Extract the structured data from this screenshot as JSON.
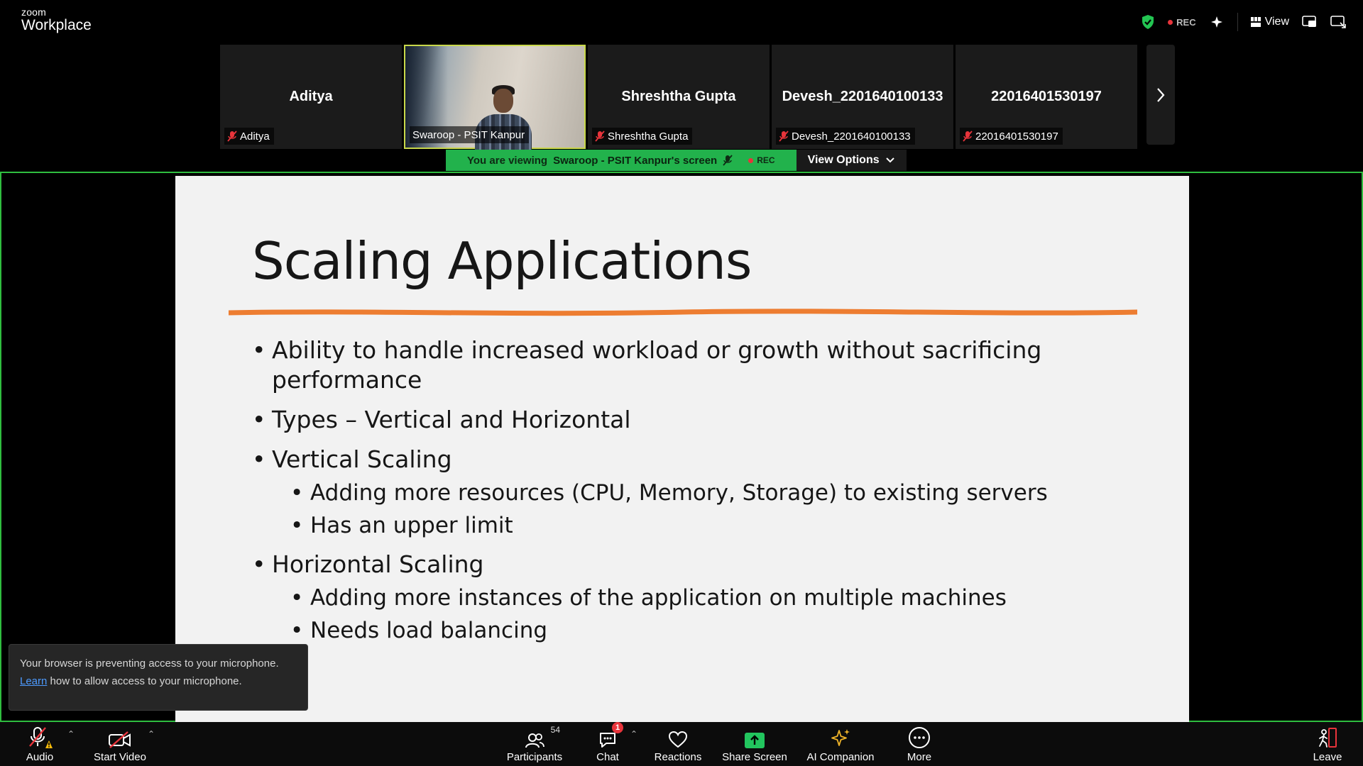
{
  "app": {
    "brand_small": "zoom",
    "brand_big": "Workplace"
  },
  "topbar": {
    "rec_label": "REC",
    "view_label": "View"
  },
  "participants_strip": [
    {
      "display_name": "Aditya",
      "tag_name": "Aditya",
      "muted": true,
      "video": false
    },
    {
      "display_name": "",
      "tag_name": "Swaroop - PSIT Kanpur",
      "muted": false,
      "video": true
    },
    {
      "display_name": "Shreshtha Gupta",
      "tag_name": "Shreshtha Gupta",
      "muted": true,
      "video": false
    },
    {
      "display_name": "Devesh_2201640100133",
      "tag_name": "Devesh_2201640100133",
      "muted": true,
      "video": false
    },
    {
      "display_name": "22016401530197",
      "tag_name": "22016401530197",
      "muted": true,
      "video": false
    }
  ],
  "banner": {
    "viewing_prefix": "You are viewing",
    "viewing_name": "Swaroop - PSIT Kanpur's screen",
    "rec_label": "REC",
    "view_options_label": "View Options"
  },
  "slide": {
    "title": "Scaling Applications",
    "bullets": [
      {
        "text": "Ability to handle increased workload or growth without sacrificing performance",
        "sub": []
      },
      {
        "text": "Types – Vertical and Horizontal",
        "sub": []
      },
      {
        "text": "Vertical Scaling",
        "sub": [
          "Adding more resources (CPU, Memory, Storage) to existing servers",
          "Has an upper limit"
        ]
      },
      {
        "text": "Horizontal Scaling",
        "sub": [
          "Adding more instances of the application on multiple machines",
          "Needs load balancing"
        ]
      }
    ],
    "accent_color": "#ed7d31"
  },
  "toast": {
    "line1": "Your browser is preventing access to your microphone.",
    "learn_link": "Learn",
    "line2_rest": " how to allow access to your microphone."
  },
  "toolbar": {
    "audio": "Audio",
    "start_video": "Start Video",
    "participants": "Participants",
    "participants_count": "54",
    "chat": "Chat",
    "chat_badge": "1",
    "reactions": "Reactions",
    "share_screen": "Share Screen",
    "ai_companion": "AI Companion",
    "more": "More",
    "leave": "Leave"
  },
  "colors": {
    "share_border": "#2fbd3f",
    "banner_green": "#22b24c",
    "share_icon": "#22c55e",
    "leave": "#e8343b",
    "ai_companion": "#f0b429"
  }
}
